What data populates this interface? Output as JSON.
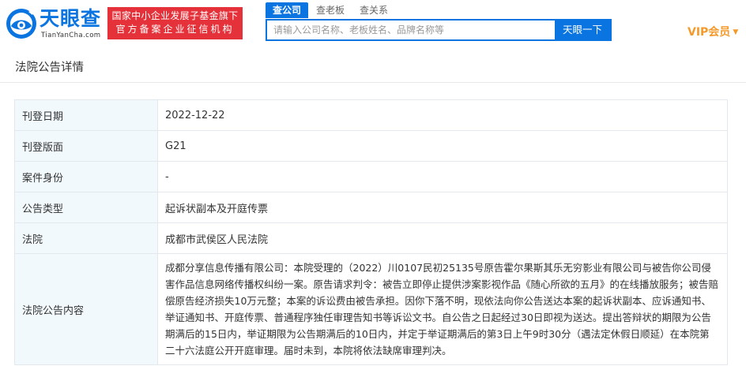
{
  "header": {
    "logo_text": "天眼查",
    "logo_domain": "TianYanCha.com",
    "slogan_line1": "国家中小企业发展子基金旗下",
    "slogan_line2": "官方备案企业征信机构",
    "tabs": [
      {
        "label": "查公司",
        "active": true
      },
      {
        "label": "查老板",
        "active": false
      },
      {
        "label": "查关系",
        "active": false
      }
    ],
    "search_placeholder": "请输入公司名称、老板姓名、品牌名称等",
    "search_button": "天眼一下",
    "vip_label": "VIP会员"
  },
  "card": {
    "title": "法院公告详情",
    "rows": [
      {
        "key": "刊登日期",
        "value": "2022-12-22"
      },
      {
        "key": "刊登版面",
        "value": "G21"
      },
      {
        "key": "案件身份",
        "value": "-"
      },
      {
        "key": "公告类型",
        "value": "起诉状副本及开庭传票"
      },
      {
        "key": "法院",
        "value": "成都市武侯区人民法院"
      },
      {
        "key": "法院公告内容",
        "value": "成都分享信息传播有限公司：本院受理的（2022）川0107民初25135号原告霍尔果斯其乐无穷影业有限公司与被告你公司侵害作品信息网络传播权纠纷一案。原告请求判令：被告立即停止提供涉案影视作品《随心所欲的五月》的在线播放服务；被告赔偿原告经济损失10万元整；本案的诉讼费由被告承担。因你下落不明，现依法向你公告送达本案的起诉状副本、应诉通知书、举证通知书、开庭传票、普通程序独任审理告知书等诉讼文书。自公告之日起经过30日即视为送达。提出答辩状的期限为公告期满后的15日内，举证期限为公告期满后的10日内，并定于举证期满后的第3日上午9时30分（遇法定休假日顺延）在本院第二十六法庭公开开庭审理。届时未到，本院将依法缺席审理判决。"
      }
    ]
  },
  "colors": {
    "brand_blue": "#0a75e0",
    "slogan_red": "#e5323a",
    "vip_orange": "#f39a2b",
    "key_cell_bg": "#f2f9fc"
  }
}
